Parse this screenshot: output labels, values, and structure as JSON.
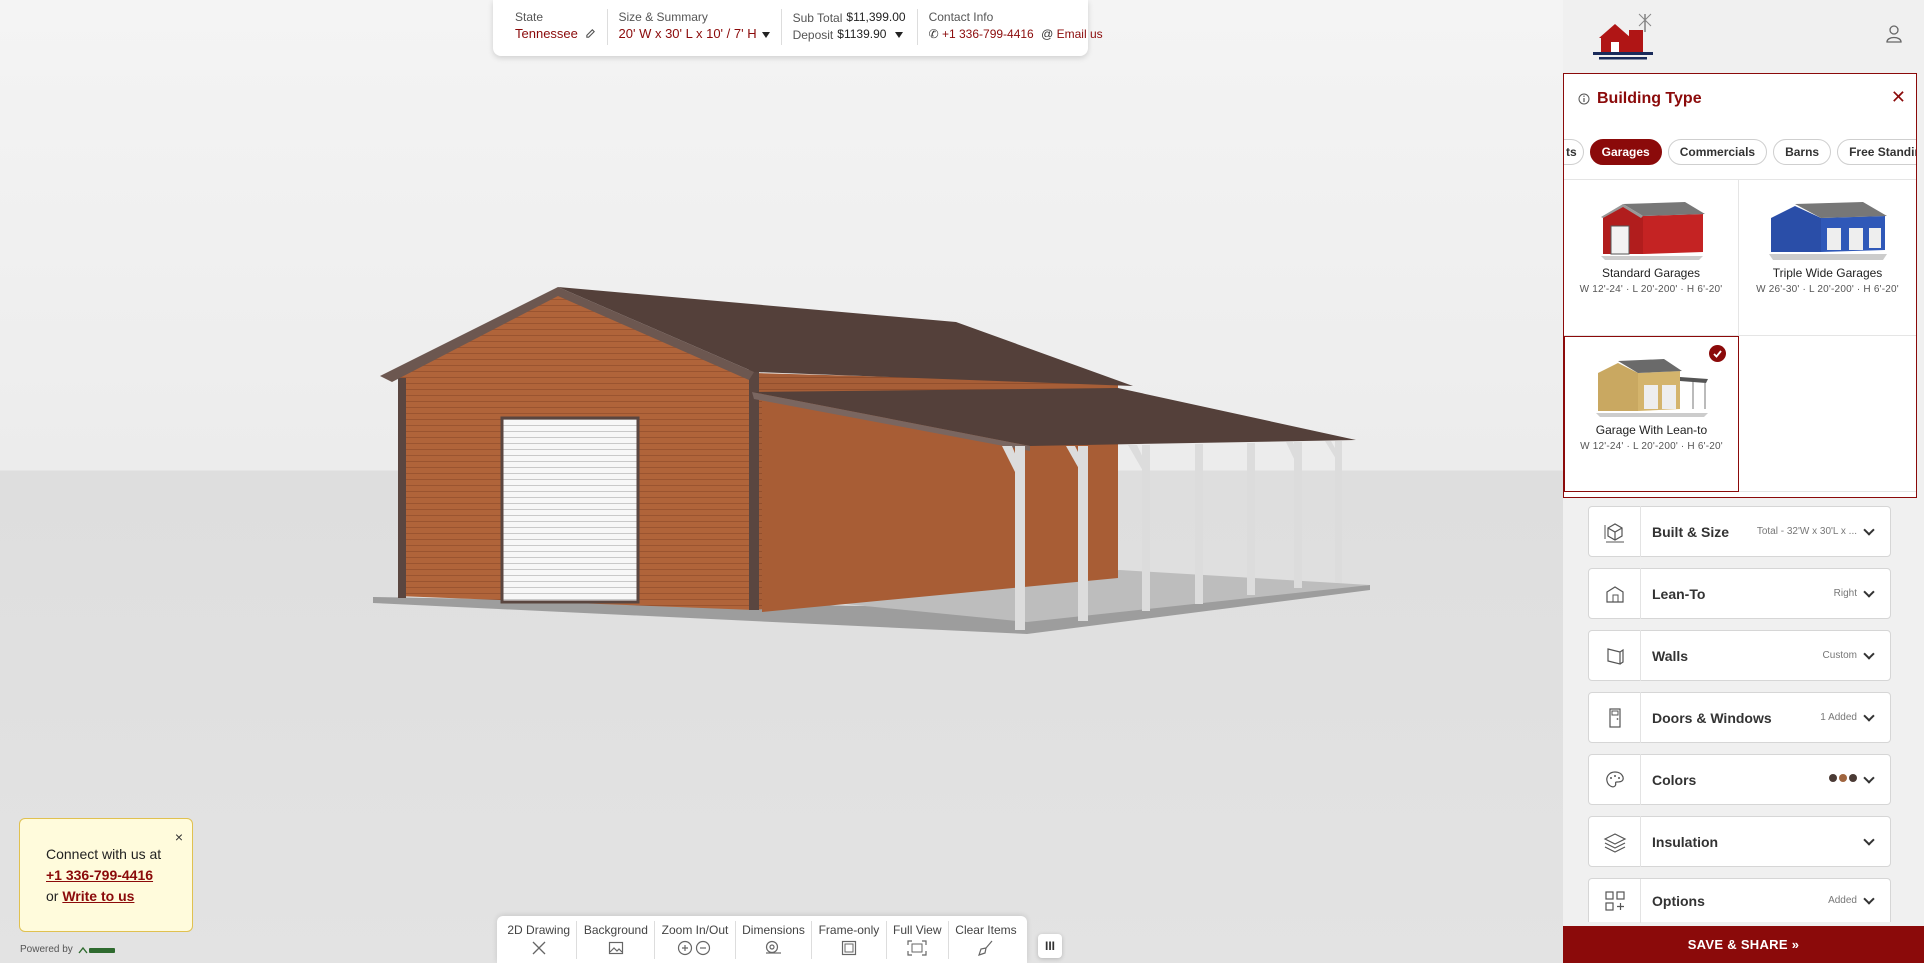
{
  "header": {
    "state_label": "State",
    "state_value": "Tennessee",
    "size_label": "Size & Summary",
    "size_value": "20' W x 30' L x 10' / 7' H",
    "subtotal_label": "Sub Total",
    "subtotal_value": "$11,399.00",
    "deposit_label": "Deposit",
    "deposit_value": "$1139.90",
    "contact_label": "Contact Info",
    "phone": "+1 336-799-4416",
    "email_label": "Email us"
  },
  "toolbar": {
    "tools": [
      {
        "label": "2D Drawing",
        "icon": "ruler-pencil-icon"
      },
      {
        "label": "Background",
        "icon": "image-icon"
      },
      {
        "label": "Zoom In/Out",
        "icon": "zoom-icon"
      },
      {
        "label": "Dimensions",
        "icon": "tape-measure-icon"
      },
      {
        "label": "Frame-only",
        "icon": "frame-icon"
      },
      {
        "label": "Full View",
        "icon": "expand-icon"
      },
      {
        "label": "Clear Items",
        "icon": "broom-icon"
      }
    ],
    "toggle_label": "III"
  },
  "contact_popup": {
    "line1": "Connect with us at",
    "phone": "+1 336-799-4416",
    "or": "or",
    "write": "Write to us",
    "close": "×"
  },
  "powered_by": "Powered by",
  "building_type": {
    "title": "Building Type",
    "close": "✕",
    "tabs": [
      {
        "label": "ts",
        "active": false
      },
      {
        "label": "Garages",
        "active": true
      },
      {
        "label": "Commercials",
        "active": false
      },
      {
        "label": "Barns",
        "active": false
      },
      {
        "label": "Free Standings",
        "active": false
      }
    ],
    "types": [
      {
        "name": "Standard Garages",
        "dims": "W 12'-24'  ·  L 20'-200'  ·  H 6'-20'",
        "selected": false
      },
      {
        "name": "Triple Wide Garages",
        "dims": "W 26'-30'  ·  L 20'-200'  ·  H 6'-20'",
        "selected": false
      },
      {
        "name": "Garage With Lean-to",
        "dims": "W 12'-24'  ·  L 20'-200'  ·  H 6'-20'",
        "selected": true
      }
    ]
  },
  "sections": [
    {
      "title": "Built & Size",
      "value": "Total - 32'W x 30'L x ...",
      "icon": "cube-icon"
    },
    {
      "title": "Lean-To",
      "value": "Right",
      "icon": "lean-to-icon"
    },
    {
      "title": "Walls",
      "value": "Custom",
      "icon": "wall-panel-icon"
    },
    {
      "title": "Doors & Windows",
      "value": "1 Added",
      "icon": "door-icon"
    },
    {
      "title": "Colors",
      "value": "",
      "icon": "palette-icon"
    },
    {
      "title": "Insulation",
      "value": "",
      "icon": "layers-icon"
    },
    {
      "title": "Options",
      "value": "Added",
      "icon": "grid-plus-icon"
    }
  ],
  "colors": {
    "accent": "#8b0a0a",
    "roof": "#54403a",
    "walls": "#b0643a",
    "trim": "#ffffff",
    "swatches": [
      "#4a3a35",
      "#a0653f",
      "#4a3a35"
    ]
  },
  "save_button": "SAVE & SHARE »"
}
